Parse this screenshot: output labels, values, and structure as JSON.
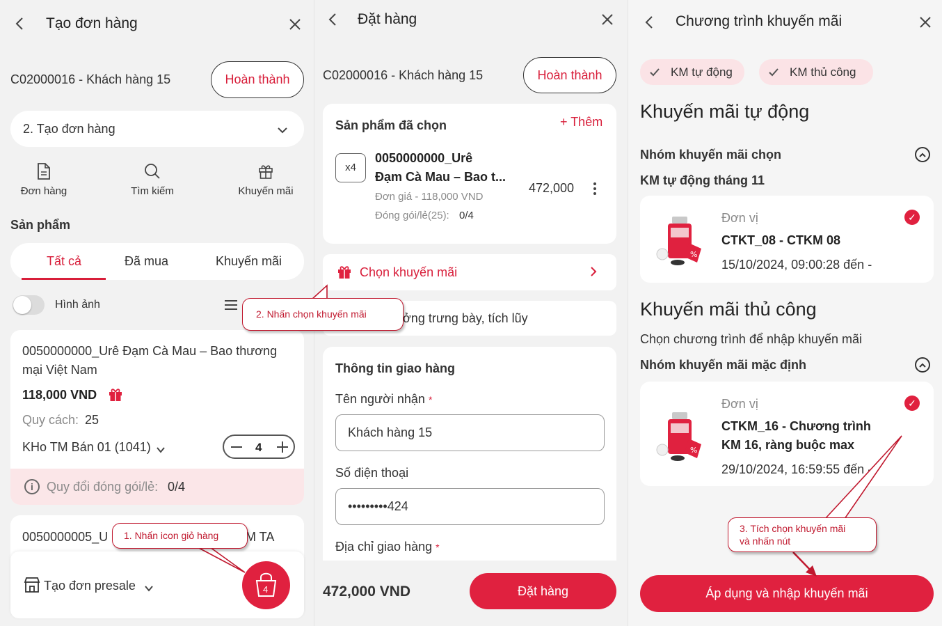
{
  "screen1": {
    "title": "Tạo đơn hàng",
    "customer": "C02000016 - Khách hàng 15",
    "complete_btn": "Hoàn thành",
    "step_select": "2. Tạo đơn hàng",
    "actions": [
      "Đơn hàng",
      "Tìm kiếm",
      "Khuyến mãi"
    ],
    "section_title": "Sản phẩm",
    "tabs": [
      "Tất cả",
      "Đã mua",
      "Khuyến mãi"
    ],
    "image_toggle_label": "Hình ảnh",
    "product1": {
      "name_line1": "0050000000_Urê Đạm Cà Mau – Bao thương",
      "name_line2": "mại Việt Nam",
      "price": "118,000 VND",
      "spec_label": "Quy cách:",
      "spec_value": "25",
      "warehouse": "KHo TM Bán 01 (1041)",
      "qty": "4",
      "convert_label": "Quy đổi đóng gói/lẻ:",
      "convert_value": "0/4"
    },
    "product2_name_start": "0050000005_U",
    "product2_name_end": "M TA",
    "presale": "Tạo đơn presale",
    "cart_count": "4"
  },
  "screen2": {
    "title": "Đặt hàng",
    "customer": "C02000016 - Khách hàng 15",
    "complete_btn": "Hoàn thành",
    "selected_title": "Sản phẩm đã chọn",
    "add_more": "+ Thêm",
    "item": {
      "qty_badge": "x4",
      "name_line1": "0050000000_Urê",
      "name_line2": "Đạm Cà Mau – Bao t...",
      "unit_price": "Đơn giá - 118,000 VND",
      "pack_label": "Đóng gói/lẻ(25):",
      "pack_value": "0/4",
      "total": "472,000"
    },
    "choose_promo": "Chọn khuyến mãi",
    "display_reward": "ởng trưng bày, tích lũy",
    "delivery_title": "Thông tin giao hàng",
    "recipient_label": "Tên người nhận",
    "recipient_value": "Khách hàng 15",
    "phone_label": "Số điện thoại",
    "phone_value": "•••••••••424",
    "address_label": "Địa chỉ giao hàng",
    "required_mark": "*",
    "grand_total": "472,000 VND",
    "order_btn": "Đặt hàng"
  },
  "screen3": {
    "title": "Chương trình khuyến mãi",
    "chips": [
      "KM tự động",
      "KM thủ công"
    ],
    "auto_title": "Khuyến mãi tự động",
    "auto_group_label": "Nhóm khuyến mãi chọn",
    "auto_group_name": "KM tự động tháng 11",
    "auto_card": {
      "unit": "Đơn vị",
      "code": "CTKT_08 - CTKM 08",
      "date": "15/10/2024, 09:00:28 đến -"
    },
    "manual_title": "Khuyến mãi thủ công",
    "manual_subtitle": "Chọn chương trình để nhập khuyến mãi",
    "manual_group_label": "Nhóm khuyến mãi mặc định",
    "manual_card": {
      "unit": "Đơn vị",
      "code_line1": "CTKM_16 - Chương trình",
      "code_line2": "KM 16, ràng buộc max",
      "date": "29/10/2024, 16:59:55 đến -"
    },
    "apply_btn": "Áp dụng và nhập khuyến mãi"
  },
  "callouts": {
    "c1": "1. Nhấn icon giỏ hàng",
    "c2": "2. Nhấn chọn khuyến mãi",
    "c3_line1": "3. Tích chọn khuyến mãi",
    "c3_line2": "và nhấn nút"
  },
  "colors": {
    "accent": "#e0213f",
    "chip_bg": "#fbe3e6",
    "warning_bg": "#fbe6e8"
  }
}
